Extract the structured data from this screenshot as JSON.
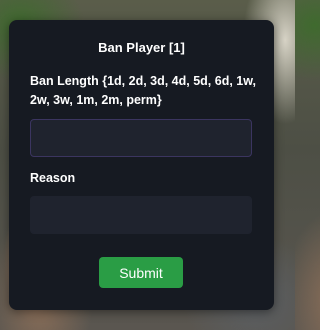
{
  "dialog": {
    "title": "Ban Player [1]",
    "ban_length_label": "Ban Length {1d, 2d, 3d, 4d, 5d, 6d, 1w, 2w, 3w, 1m, 2m, perm}",
    "ban_length_value": "",
    "reason_label": "Reason",
    "reason_value": "",
    "submit_label": "Submit"
  },
  "colors": {
    "panel_background": "#161a22",
    "input_background": "#1f232e",
    "focused_input_border": "#3b3560",
    "submit_background": "#2a9d45",
    "text": "#ffffff"
  }
}
